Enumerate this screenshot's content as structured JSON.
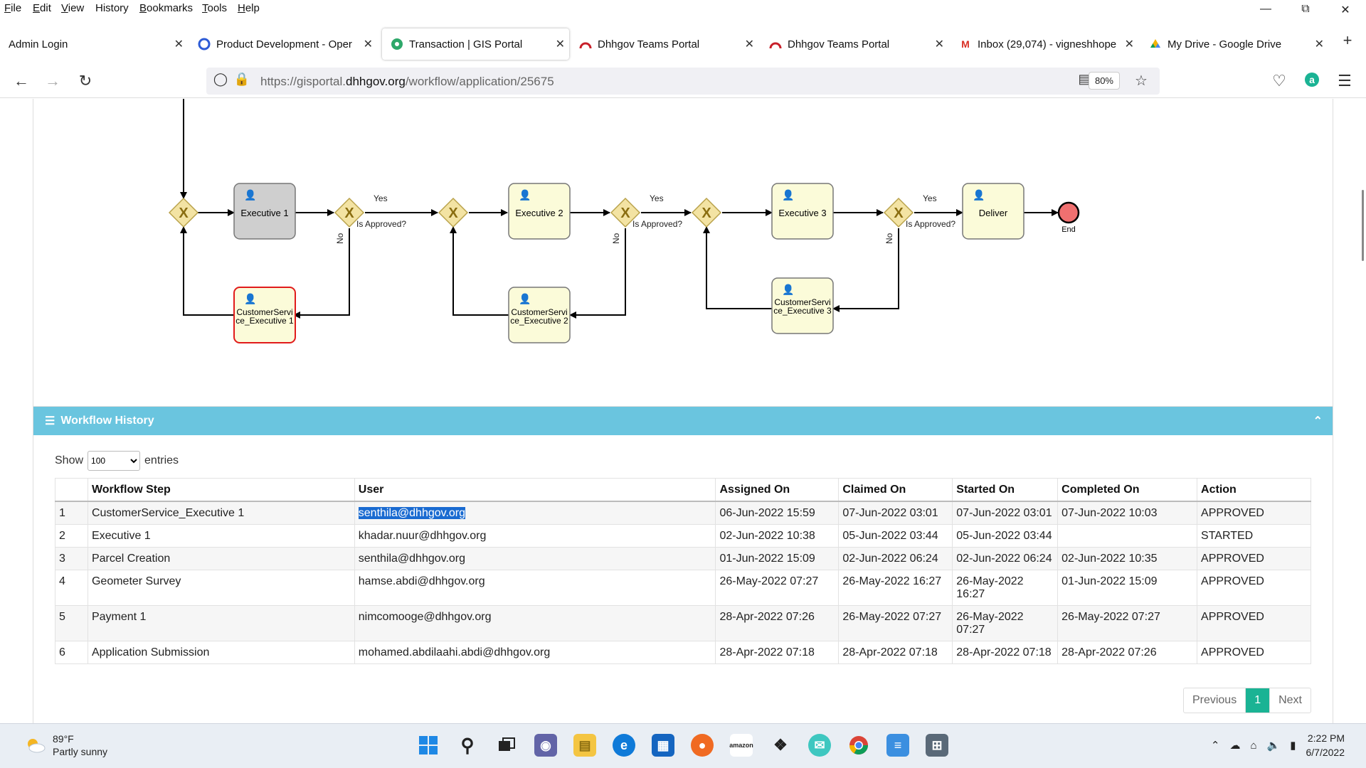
{
  "menubar": {
    "items": [
      {
        "u": "F",
        "rest": "ile"
      },
      {
        "u": "E",
        "rest": "dit"
      },
      {
        "u": "V",
        "rest": "iew"
      },
      {
        "u": "",
        "rest": "History"
      },
      {
        "u": "B",
        "rest": "ookmarks"
      },
      {
        "u": "T",
        "rest": "ools"
      },
      {
        "u": "H",
        "rest": "elp"
      }
    ]
  },
  "tabs": [
    {
      "title": "Admin Login",
      "icon": "none"
    },
    {
      "title": "Product Development - Oper",
      "icon": "circle-icon"
    },
    {
      "title": "Transaction | GIS Portal",
      "icon": "gis-icon"
    },
    {
      "title": "Dhhgov Teams Portal",
      "icon": "arch-icon"
    },
    {
      "title": "Dhhgov Teams Portal",
      "icon": "arch-icon"
    },
    {
      "title": "Inbox (29,074) - vigneshhope",
      "icon": "gmail-icon"
    },
    {
      "title": "My Drive - Google Drive",
      "icon": "drive-icon"
    }
  ],
  "address": {
    "prefix": "https://gisportal.",
    "domain": "dhhgov.org",
    "path": "/workflow/application/25675",
    "zoom": "80%"
  },
  "diagram": {
    "tasks": {
      "exec1": "Executive 1",
      "exec2": "Executive 2",
      "exec3": "Executive 3",
      "deliver": "Deliver",
      "cs1_a": "CustomerServi",
      "cs1_b": "ce_Executive 1",
      "cs2_a": "CustomerServi",
      "cs2_b": "ce_Executive 2",
      "cs3_a": "CustomerServi",
      "cs3_b": "ce_Executive 3"
    },
    "yes": "Yes",
    "no": "No",
    "approved": "Is Approved?",
    "end": "End",
    "colors": {
      "task_fill": "#fbfbd9",
      "task_active": "#cfcfcf",
      "task_error_border": "#e11b1b",
      "gateway_fill": "#f3e3a3",
      "end_fill": "#f07070"
    }
  },
  "history": {
    "title": "Workflow History",
    "show_label": "Show",
    "show_value": "100",
    "entries_label": "entries",
    "columns": [
      "",
      "Workflow Step",
      "User",
      "Assigned On",
      "Claimed On",
      "Started On",
      "Completed On",
      "Action"
    ],
    "rows": [
      [
        "1",
        "CustomerService_Executive 1",
        "senthila@dhhgov.org",
        "06-Jun-2022 15:59",
        "07-Jun-2022 03:01",
        "07-Jun-2022 03:01",
        "07-Jun-2022 10:03",
        "APPROVED"
      ],
      [
        "2",
        "Executive 1",
        "khadar.nuur@dhhgov.org",
        "02-Jun-2022 10:38",
        "05-Jun-2022 03:44",
        "05-Jun-2022 03:44",
        "",
        "STARTED"
      ],
      [
        "3",
        "Parcel Creation",
        "senthila@dhhgov.org",
        "01-Jun-2022 15:09",
        "02-Jun-2022 06:24",
        "02-Jun-2022 06:24",
        "02-Jun-2022 10:35",
        "APPROVED"
      ],
      [
        "4",
        "Geometer Survey",
        "hamse.abdi@dhhgov.org",
        "26-May-2022 07:27",
        "26-May-2022 16:27",
        "26-May-2022 16:27",
        "01-Jun-2022 15:09",
        "APPROVED"
      ],
      [
        "5",
        "Payment 1",
        "nimcomooge@dhhgov.org",
        "28-Apr-2022 07:26",
        "26-May-2022 07:27",
        "26-May-2022 07:27",
        "26-May-2022 07:27",
        "APPROVED"
      ],
      [
        "6",
        "Application Submission",
        "mohamed.abdilaahi.abdi@dhhgov.org",
        "28-Apr-2022 07:18",
        "28-Apr-2022 07:18",
        "28-Apr-2022 07:18",
        "28-Apr-2022 07:26",
        "APPROVED"
      ]
    ],
    "pager": {
      "prev": "Previous",
      "current": "1",
      "next": "Next"
    },
    "colors": {
      "header": "#6ac5df",
      "approved": "#2bbc86",
      "pager_active": "#1ab394"
    }
  },
  "taskbar": {
    "temp": "89°F",
    "weather": "Partly sunny",
    "time": "2:22 PM",
    "date": "6/7/2022",
    "apps": [
      "windows-icon",
      "search-icon",
      "task-view-icon",
      "teams-chat-icon",
      "file-explorer-icon",
      "edge-icon",
      "store-icon",
      "firefox-icon",
      "amazon-icon",
      "dropbox-icon",
      "mail-icon",
      "chrome-icon",
      "notepad-icon",
      "calculator-icon"
    ]
  }
}
